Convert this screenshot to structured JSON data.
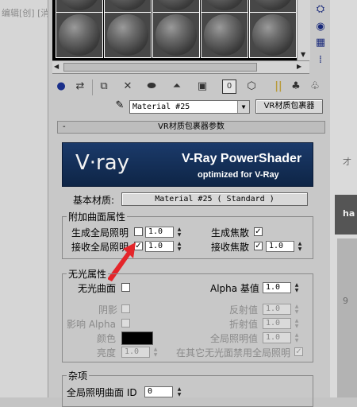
{
  "background_app": {
    "left_text": "编辑[创] [消",
    "right_texts": [
      "才",
      "ha",
      "9"
    ]
  },
  "material_slots": {
    "count": 8
  },
  "material_select": {
    "value": "Material #25"
  },
  "material_type_button": "VR材质包裹器",
  "rollout": {
    "title": "VR材质包裹器参数",
    "banner": {
      "logo": "V·ray",
      "title": "V-Ray PowerShader",
      "subtitle": "optimized for V-Ray"
    },
    "base_material": {
      "label": "基本材质:",
      "value": "Material #25  ( Standard )"
    },
    "extra_surface": {
      "title": "附加曲面属性",
      "generate_gi": {
        "label": "生成全局照明",
        "checked": false,
        "value": "1.0"
      },
      "receive_gi": {
        "label": "接收全局照明",
        "checked": true,
        "value": "1.0"
      },
      "generate_caustics": {
        "label": "生成焦散",
        "checked": true
      },
      "receive_caustics": {
        "label": "接收焦散",
        "checked": true,
        "value": "1.0"
      }
    },
    "matte": {
      "title": "无光属性",
      "matte_surface": {
        "label": "无光曲面",
        "checked": false
      },
      "alpha_contribution": {
        "label": "Alpha 基值",
        "value": "1.0"
      },
      "shadows": {
        "label": "阴影",
        "checked": false
      },
      "affect_alpha": {
        "label": "影响 Alpha",
        "checked": false
      },
      "color": {
        "label": "颜色",
        "value": "#000000"
      },
      "brightness": {
        "label": "亮度",
        "value": "1.0"
      },
      "reflection_amount": {
        "label": "反射值",
        "value": "1.0"
      },
      "refraction_amount": {
        "label": "折射值",
        "value": "1.0"
      },
      "gi_amount": {
        "label": "全局照明值",
        "value": "1.0"
      },
      "no_gi_on_other_mattes": {
        "label": "在其它无光面禁用全局照明",
        "checked": true
      }
    },
    "misc": {
      "title": "杂项",
      "gi_surface_id": {
        "label": "全局照明曲面 ID",
        "value": "0"
      }
    }
  },
  "colors": {
    "accent_red": "#e4252a",
    "banner_blue": "#163260"
  }
}
